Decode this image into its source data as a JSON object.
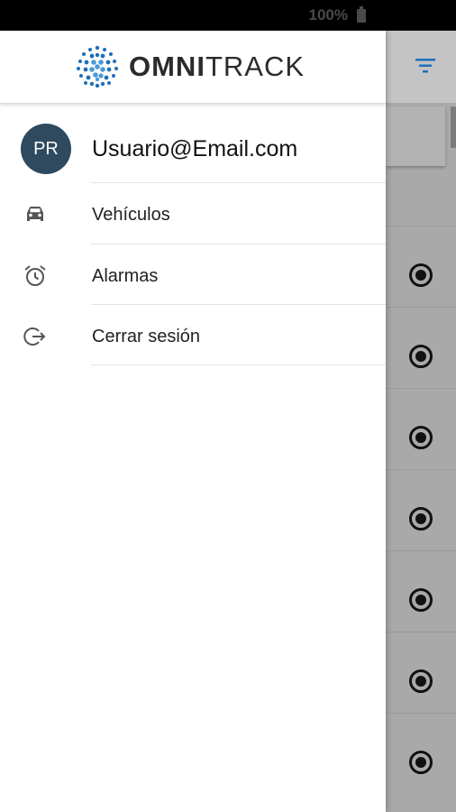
{
  "status_bar": {
    "battery_text": "100%"
  },
  "drawer": {
    "logo_text_bold": "OMNI",
    "logo_text_regular": "TRACK",
    "user": {
      "initials": "PR",
      "email": "Usuario@Email.com"
    },
    "menu": [
      {
        "label": "Vehículos",
        "icon": "car-icon"
      },
      {
        "label": "Alarmas",
        "icon": "alarm-clock-icon"
      },
      {
        "label": "Cerrar sesión",
        "icon": "logout-icon"
      }
    ]
  },
  "background_app": {
    "toolbar_icon": "filter-icon",
    "row_icon": "radio-selected-icon",
    "rows": 7
  },
  "colors": {
    "avatar_bg": "#2f4a5f",
    "accent": "#1e6fb8",
    "scrim": "#a9a9a9"
  }
}
